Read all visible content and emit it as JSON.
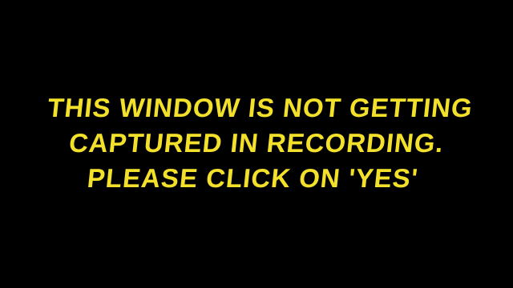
{
  "notice": {
    "lines": [
      "This window is not getting",
      "captured in recording.",
      "Please click on 'Yes'"
    ]
  },
  "colors": {
    "background": "#000000",
    "text": "#f2e02a"
  }
}
